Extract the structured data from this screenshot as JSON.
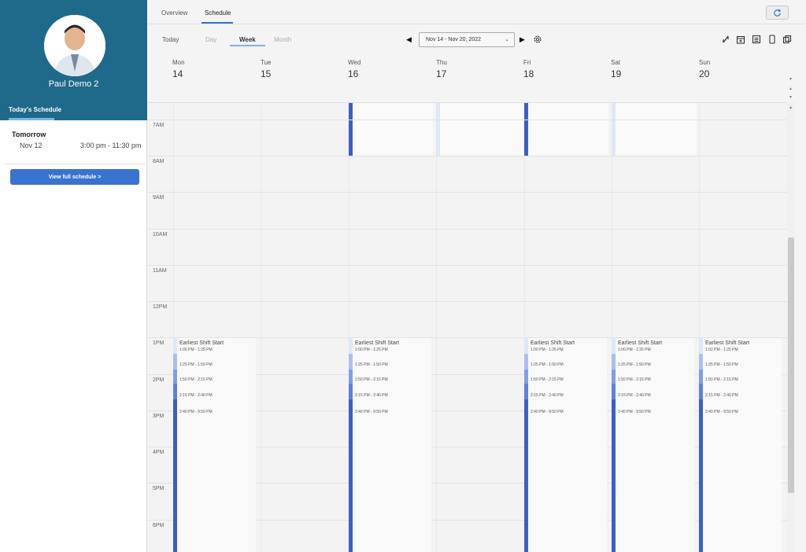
{
  "left_panel": {
    "user_name": "Paul Demo 2",
    "today_tab": "Today's Schedule",
    "tomorrow": {
      "label": "Tomorrow",
      "date": "Nov 12",
      "time": "3:00 pm - 11:30 pm"
    },
    "view_full_button": "View full schedule >"
  },
  "top_tabs": {
    "overview": "Overview",
    "schedule": "Schedule"
  },
  "view_switcher": {
    "today": "Today",
    "day": "Day",
    "week": "Week",
    "month": "Month",
    "active": "Week"
  },
  "date_range": "Nov 14 - Nov 20, 2022",
  "days": [
    {
      "name": "Mon",
      "num": "14"
    },
    {
      "name": "Tue",
      "num": "15"
    },
    {
      "name": "Wed",
      "num": "16"
    },
    {
      "name": "Thu",
      "num": "17"
    },
    {
      "name": "Fri",
      "num": "18"
    },
    {
      "name": "Sat",
      "num": "19"
    },
    {
      "name": "Sun",
      "num": "20"
    }
  ],
  "hours": [
    "7AM",
    "8AM",
    "9AM",
    "10AM",
    "11AM",
    "12PM",
    "1PM",
    "2PM",
    "3PM",
    "4PM",
    "5PM",
    "6PM"
  ],
  "shifts": {
    "title": "Earliest Shift Start",
    "lines": [
      "1:00 PM - 1:25 PM",
      "1:25 PM - 1:50 PM",
      "1:50 PM - 2:15 PM",
      "2:15 PM - 2:40 PM",
      "2:40 PM - 9:50 PM"
    ],
    "first_line_variant": "1:02 PM - 1:25 PM"
  },
  "colors": {
    "header_bg": "#1f6a8a",
    "accent": "#3a72d0",
    "shift_bar": "#3a5fc8"
  },
  "icons": [
    "refresh-icon",
    "settings-icon",
    "swap-icon",
    "calendar-add-icon",
    "list-icon",
    "mobile-icon",
    "copy-icon"
  ]
}
